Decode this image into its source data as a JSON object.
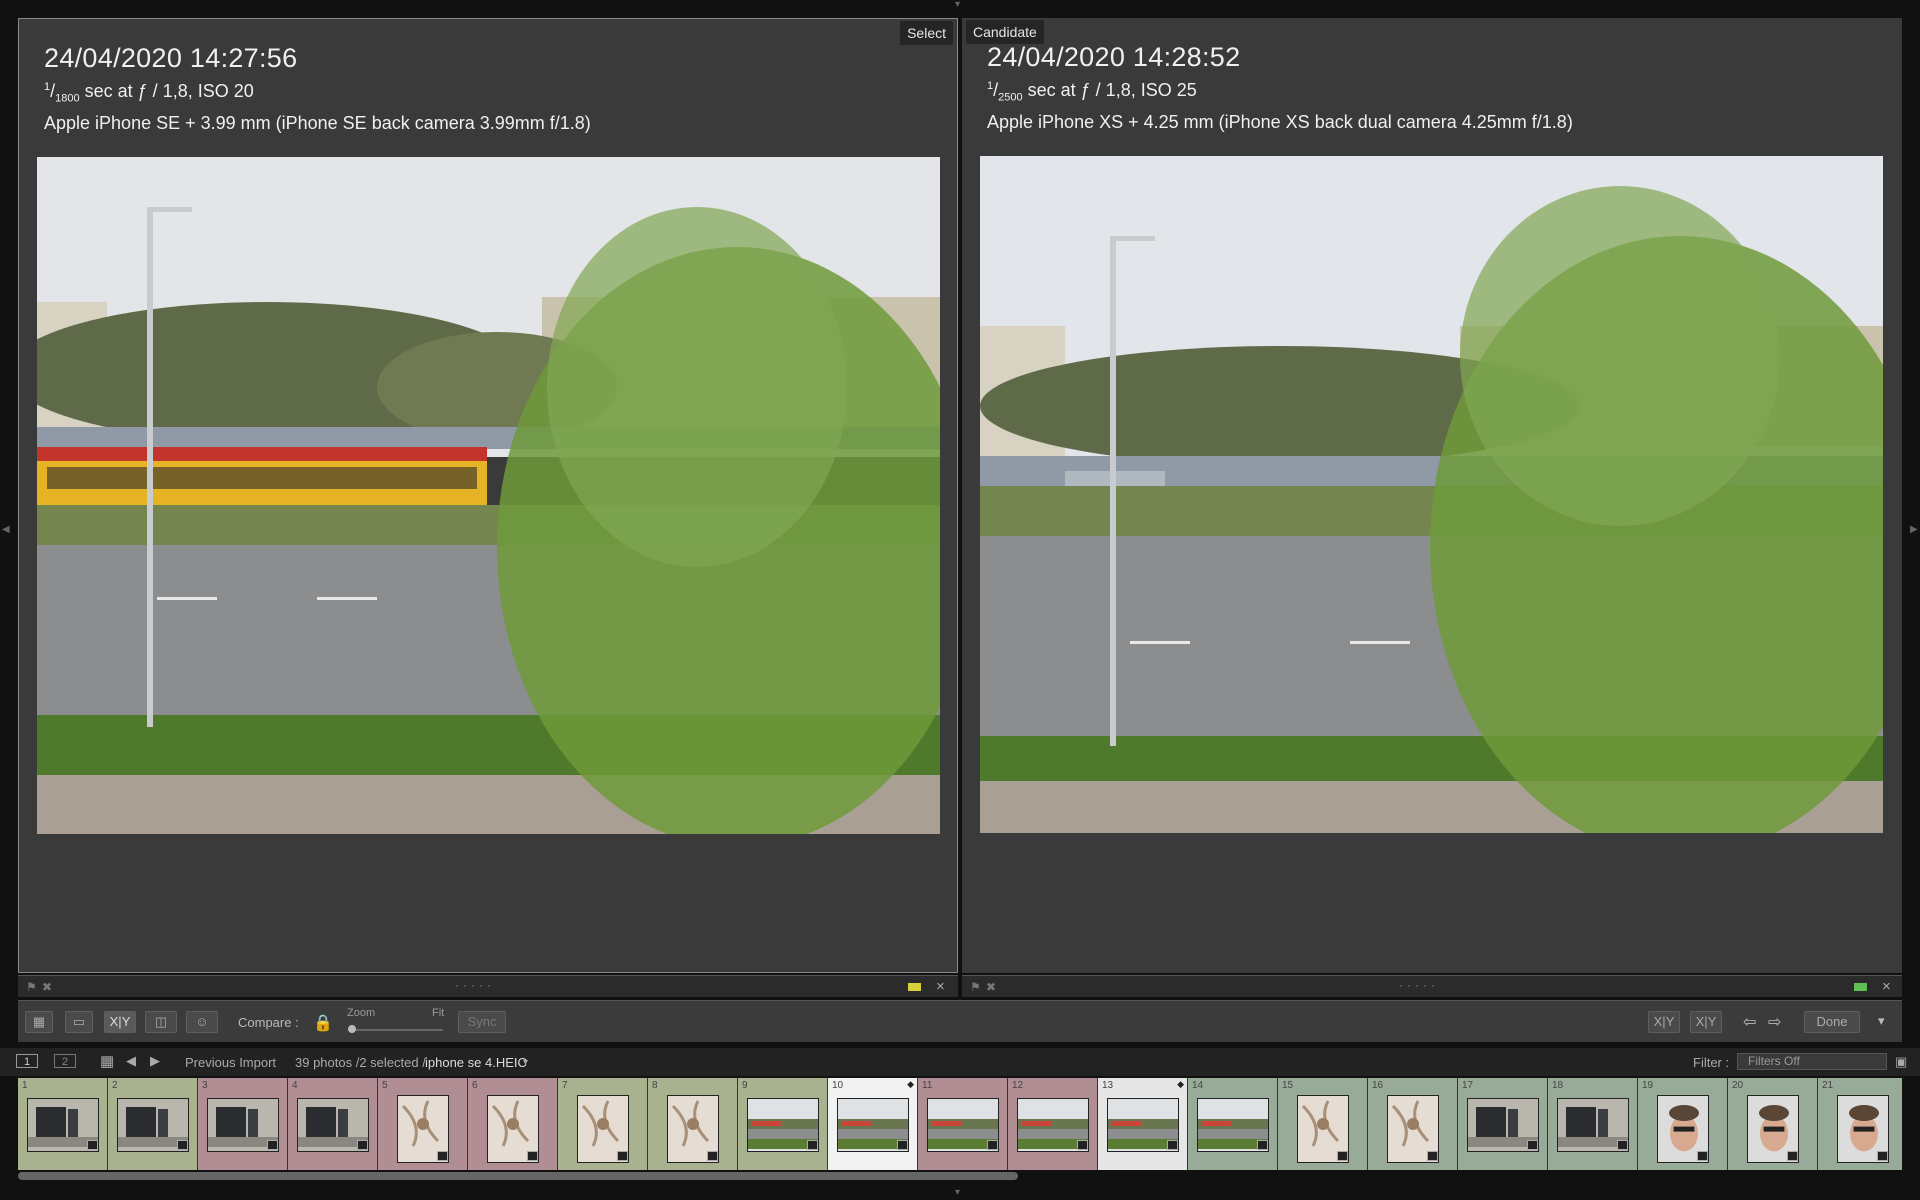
{
  "left_pane": {
    "tag": "Select",
    "datetime": "24/04/2020 14:27:56",
    "shutter_num": "1",
    "shutter_den": "1800",
    "exposure_rest": "sec at ƒ / 1,8, ISO 20",
    "camera": "Apple iPhone SE + 3.99 mm (iPhone SE back camera 3.99mm f/1.8)",
    "label_color": "#d7d23a"
  },
  "right_pane": {
    "tag": "Candidate",
    "datetime": "24/04/2020 14:28:52",
    "shutter_num": "1",
    "shutter_den": "2500",
    "exposure_rest": "sec at ƒ / 1,8, ISO 25",
    "camera": "Apple iPhone XS + 4.25 mm (iPhone XS back dual camera 4.25mm f/1.8)",
    "label_color": "#5fbf55"
  },
  "toolbar": {
    "compare_label": "Compare :",
    "zoom_label": "Zoom",
    "fit_label": "Fit",
    "sync_label": "Sync",
    "done_label": "Done",
    "xy_label": "X|Y"
  },
  "filmstrip_header": {
    "monitor_1": "1",
    "monitor_2": "2",
    "source": "Previous Import",
    "count": "39 photos /2 selected /",
    "filename": "iphone se 4.HEIC",
    "filter_label": "Filter :",
    "filter_value": "Filters Off"
  },
  "filmstrip": [
    {
      "num": "1",
      "kind": "room",
      "bg": "#a9b28e"
    },
    {
      "num": "2",
      "kind": "room",
      "bg": "#a9b28e"
    },
    {
      "num": "3",
      "kind": "room",
      "bg": "#b08e93"
    },
    {
      "num": "4",
      "kind": "room",
      "bg": "#b08e93"
    },
    {
      "num": "5",
      "kind": "fabric",
      "bg": "#b08e93"
    },
    {
      "num": "6",
      "kind": "fabric",
      "bg": "#b08e93"
    },
    {
      "num": "7",
      "kind": "fabric",
      "bg": "#a9b28e"
    },
    {
      "num": "8",
      "kind": "fabric",
      "bg": "#a9b28e"
    },
    {
      "num": "9",
      "kind": "street",
      "bg": "#a9b28e"
    },
    {
      "num": "10",
      "kind": "street",
      "bg": "#f2f2f2",
      "selected": true
    },
    {
      "num": "11",
      "kind": "street",
      "bg": "#b08e93"
    },
    {
      "num": "12",
      "kind": "street",
      "bg": "#b08e93"
    },
    {
      "num": "13",
      "kind": "street",
      "bg": "#e6e6e6",
      "selected": true
    },
    {
      "num": "14",
      "kind": "street",
      "bg": "#97ab98"
    },
    {
      "num": "15",
      "kind": "fabric",
      "bg": "#97ab98"
    },
    {
      "num": "16",
      "kind": "fabric",
      "bg": "#97ab98"
    },
    {
      "num": "17",
      "kind": "room",
      "bg": "#97ab98"
    },
    {
      "num": "18",
      "kind": "room",
      "bg": "#97ab98"
    },
    {
      "num": "19",
      "kind": "face",
      "bg": "#97ab98"
    },
    {
      "num": "20",
      "kind": "face",
      "bg": "#97ab98"
    },
    {
      "num": "21",
      "kind": "face",
      "bg": "#97ab98"
    }
  ]
}
